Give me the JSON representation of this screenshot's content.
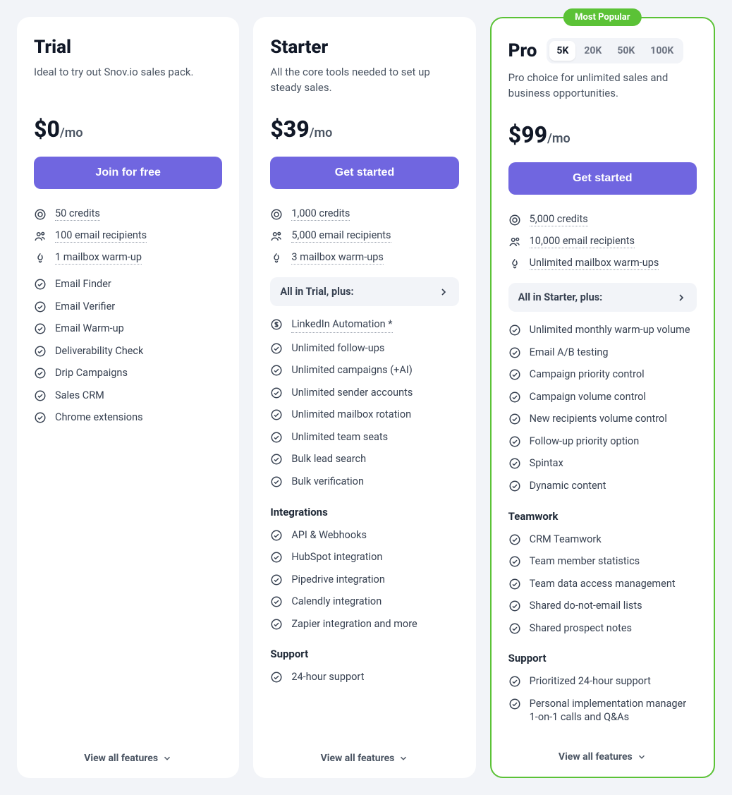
{
  "plans": [
    {
      "title": "Trial",
      "desc": "Ideal to try out Snov.io sales pack.",
      "price": "$0",
      "per": "/mo",
      "cta": "Join for free",
      "highlighted": false,
      "tiers": null,
      "metrics": [
        {
          "icon": "credits",
          "text": "50 credits"
        },
        {
          "icon": "recipients",
          "text": "100 email recipients"
        },
        {
          "icon": "warmup",
          "text": "1 mailbox warm-up"
        }
      ],
      "inherit": null,
      "sections": [
        {
          "title": null,
          "items": [
            {
              "text": "Email Finder",
              "link": false
            },
            {
              "text": "Email Verifier",
              "link": false
            },
            {
              "text": "Email Warm-up",
              "link": false
            },
            {
              "text": "Deliverability Check",
              "link": false
            },
            {
              "text": "Drip Campaigns",
              "link": false
            },
            {
              "text": "Sales CRM",
              "link": false
            },
            {
              "text": "Chrome extensions",
              "link": false
            }
          ]
        }
      ],
      "view_all": "View all features"
    },
    {
      "title": "Starter",
      "desc": "All the core tools needed to set up steady sales.",
      "price": "$39",
      "per": "/mo",
      "cta": "Get started",
      "highlighted": false,
      "tiers": null,
      "metrics": [
        {
          "icon": "credits",
          "text": "1,000 credits"
        },
        {
          "icon": "recipients",
          "text": "5,000 email recipients"
        },
        {
          "icon": "warmup",
          "text": "3 mailbox warm-ups"
        }
      ],
      "inherit": "All in Trial, plus:",
      "sections": [
        {
          "title": null,
          "items": [
            {
              "text": "LinkedIn Automation *",
              "link": true,
              "icon": "dollar"
            },
            {
              "text": "Unlimited follow-ups",
              "link": false
            },
            {
              "text": "Unlimited campaigns (+AI)",
              "link": false
            },
            {
              "text": "Unlimited sender accounts",
              "link": false
            },
            {
              "text": "Unlimited mailbox rotation",
              "link": false
            },
            {
              "text": "Unlimited team seats",
              "link": false
            },
            {
              "text": "Bulk lead search",
              "link": false
            },
            {
              "text": "Bulk verification",
              "link": false
            }
          ]
        },
        {
          "title": "Integrations",
          "items": [
            {
              "text": "API & Webhooks",
              "link": false
            },
            {
              "text": "HubSpot integration",
              "link": false
            },
            {
              "text": "Pipedrive integration",
              "link": false
            },
            {
              "text": "Calendly integration",
              "link": false
            },
            {
              "text": "Zapier integration and more",
              "link": false
            }
          ]
        },
        {
          "title": "Support",
          "items": [
            {
              "text": "24-hour support",
              "link": false
            }
          ]
        }
      ],
      "view_all": "View all features"
    },
    {
      "title": "Pro",
      "desc": "Pro choice for unlimited sales and business opportunities.",
      "price": "$99",
      "per": "/mo",
      "cta": "Get started",
      "highlighted": true,
      "badge": "Most Popular",
      "tiers": {
        "options": [
          "5K",
          "20K",
          "50K",
          "100K"
        ],
        "active": 0
      },
      "metrics": [
        {
          "icon": "credits",
          "text": "5,000 credits"
        },
        {
          "icon": "recipients",
          "text": "10,000 email recipients"
        },
        {
          "icon": "warmup",
          "text": "Unlimited mailbox warm-ups"
        }
      ],
      "inherit": "All in Starter, plus:",
      "sections": [
        {
          "title": null,
          "items": [
            {
              "text": "Unlimited monthly warm-up volume",
              "link": false
            },
            {
              "text": "Email A/B testing",
              "link": false
            },
            {
              "text": "Campaign priority control",
              "link": false
            },
            {
              "text": "Campaign volume control",
              "link": false
            },
            {
              "text": "New recipients volume control",
              "link": false
            },
            {
              "text": "Follow-up priority option",
              "link": false
            },
            {
              "text": "Spintax",
              "link": false
            },
            {
              "text": "Dynamic content",
              "link": false
            }
          ]
        },
        {
          "title": "Teamwork",
          "items": [
            {
              "text": "CRM Teamwork",
              "link": false
            },
            {
              "text": "Team member statistics",
              "link": false
            },
            {
              "text": "Team data access management",
              "link": false
            },
            {
              "text": "Shared do-not-email lists",
              "link": false
            },
            {
              "text": "Shared prospect notes",
              "link": false
            }
          ]
        },
        {
          "title": "Support",
          "items": [
            {
              "text": "Prioritized 24-hour support",
              "link": false
            },
            {
              "text": "Personal implementation manager 1-on-1 calls and Q&As",
              "link": false
            }
          ]
        }
      ],
      "view_all": "View all features"
    }
  ]
}
